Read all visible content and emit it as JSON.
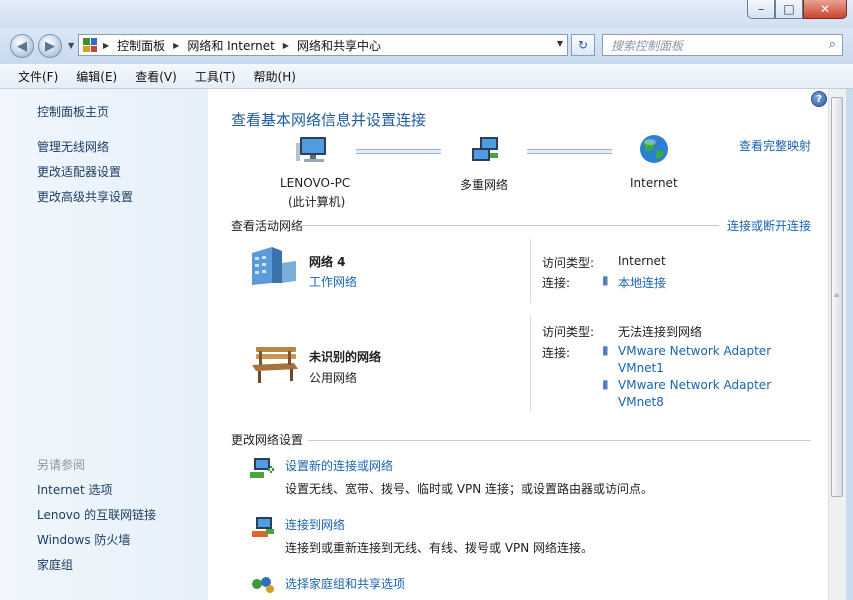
{
  "window": {
    "minimize": "–",
    "maximize": "□",
    "close": "✕"
  },
  "nav": {
    "back": "◀",
    "forward": "▶",
    "breadcrumbs": [
      "控制面板",
      "网络和 Internet",
      "网络和共享中心"
    ],
    "refresh": "↻",
    "search_placeholder": "搜索控制面板",
    "search_icon": "⌕"
  },
  "menu": [
    "文件(F)",
    "编辑(E)",
    "查看(V)",
    "工具(T)",
    "帮助(H)"
  ],
  "sidebar": {
    "home": "控制面板主页",
    "links": [
      "管理无线网络",
      "更改适配器设置",
      "更改高级共享设置"
    ],
    "see_also_title": "另请参阅",
    "see_also": [
      "Internet 选项",
      "Lenovo 的互联网链接",
      "Windows 防火墙",
      "家庭组"
    ]
  },
  "main": {
    "title": "查看基本网络信息并设置连接",
    "full_map": "查看完整映射",
    "map": {
      "computer": "LENOVO-PC",
      "computer_sub": "(此计算机)",
      "middle": "多重网络",
      "internet": "Internet"
    },
    "active_title": "查看活动网络",
    "connect_disconnect": "连接或断开连接",
    "net1": {
      "name": "网络  4",
      "type": "工作网络",
      "access_label": "访问类型:",
      "access_value": "Internet",
      "conn_label": "连接:",
      "conn_value": "本地连接"
    },
    "net2": {
      "name": "未识别的网络",
      "type": "公用网络",
      "access_label": "访问类型:",
      "access_value": "无法连接到网络",
      "conn_label": "连接:",
      "conn_value1a": "VMware Network Adapter",
      "conn_value1b": "VMnet1",
      "conn_value2a": "VMware Network Adapter",
      "conn_value2b": "VMnet8"
    },
    "change_title": "更改网络设置",
    "tasks": [
      {
        "title": "设置新的连接或网络",
        "desc": "设置无线、宽带、拨号、临时或 VPN 连接；或设置路由器或访问点。"
      },
      {
        "title": "连接到网络",
        "desc": "连接到或重新连接到无线、有线、拨号或 VPN 网络连接。"
      },
      {
        "title": "选择家庭组和共享选项",
        "desc": ""
      }
    ]
  },
  "help_icon": "?"
}
